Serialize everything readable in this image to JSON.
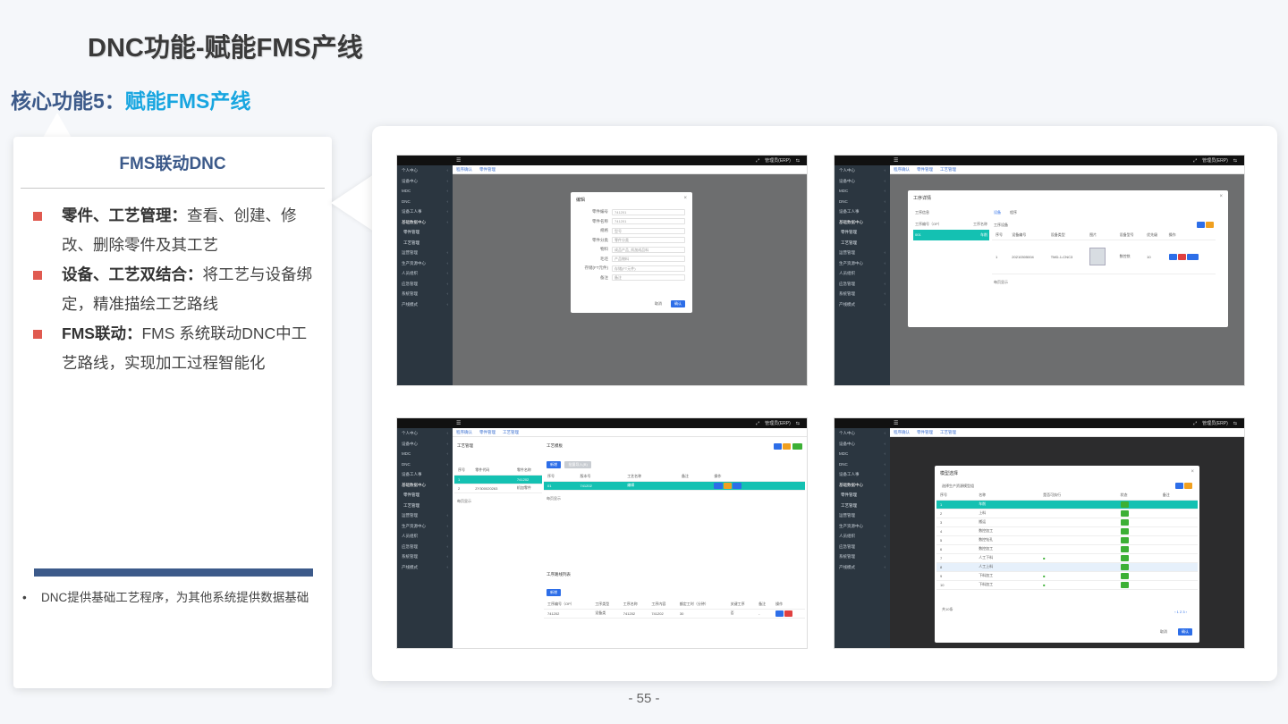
{
  "slide": {
    "title": "DNC功能-赋能FMS产线",
    "subtitle_prefix": "核心功能5：",
    "subtitle_highlight": "赋能FMS产线",
    "page_number": "- 55 -"
  },
  "card": {
    "heading": "FMS联动DNC",
    "bullets": [
      {
        "bold": "零件、工艺管理：",
        "text": "查看、创建、修改、删除零件及其工艺"
      },
      {
        "bold": "设备、工艺双结合：",
        "text": "将工艺与设备绑定，精准描绘工艺路线"
      },
      {
        "bold": "FMS联动：",
        "text": "FMS 系统联动DNC中工艺路线，实现加工过程智能化"
      }
    ],
    "note": "DNC提供基础工艺程序，为其他系统提供数据基础"
  },
  "colors": {
    "accent_blue": "#3c5a8a",
    "highlight": "#18a6e0",
    "bullet_red": "#e05a50",
    "teal_select": "#14c1b2"
  },
  "screenshots": {
    "sidebar_items": [
      "个人中心",
      "设备中心",
      "MDC",
      "DNC",
      "设备工人事",
      "基础数据中心",
      "零件管理",
      "工艺管理",
      "运营管理",
      "生产资源中心",
      "人员组织",
      "应急管理",
      "系统管理",
      "产线模式"
    ],
    "user_label": "管理员(ERP)",
    "shot1": {
      "tabs": [
        "程序确认",
        "零件管理"
      ],
      "dialog_title": "编辑",
      "fields": [
        {
          "label": "零件编号",
          "value": "741201"
        },
        {
          "label": "零件名称",
          "value": "741201"
        },
        {
          "label": "规格",
          "value": "型号"
        },
        {
          "label": "零件分类",
          "value": "零件分类"
        },
        {
          "label": "物料",
          "value": "成品产品_机加成品料"
        },
        {
          "label": "毛坯",
          "value": "产品物料"
        },
        {
          "label": "存储(FT元件)",
          "value": "存储(FT元件)"
        },
        {
          "label": "备注",
          "value": "备注"
        }
      ],
      "cancel": "取消",
      "confirm": "确认"
    },
    "shot2": {
      "tabs": [
        "程序确认",
        "零件管理",
        "工艺管理"
      ],
      "dialog_title": "工序详情",
      "left_tabs": [
        "工序信息"
      ],
      "left_cols": [
        "工序编号（OP）",
        "工序名称"
      ],
      "left_row": [
        "001",
        "车削"
      ],
      "right_tabs": [
        "设备",
        "程序"
      ],
      "right_label": "工序设备",
      "table_cols": [
        "序号",
        "设备编号",
        "设备类型",
        "图片",
        "设备型号",
        "优先级",
        "操作"
      ],
      "row": [
        "1",
        "20210305004",
        "TMD-1-CNC3",
        "",
        "数控铣",
        "10",
        ""
      ],
      "pager": "每页显示"
    },
    "shot3": {
      "tabs": [
        "程序确认",
        "零件管理",
        "工艺管理"
      ],
      "left_title": "工艺管理",
      "left_cols": [
        "序号",
        "零件代码",
        "零件名称"
      ],
      "left_rows": [
        [
          "1",
          "",
          "741202"
        ],
        [
          "2",
          "ZY300020263",
          "机加零件"
        ]
      ],
      "right_title": "工艺模板",
      "btn_add": "新增",
      "btn_import": "批量导入(B)",
      "right_cols": [
        "序号",
        "版本号",
        "工艺名称",
        "备注",
        "操作"
      ],
      "right_row": [
        "01",
        "741202",
        "编辑",
        "",
        ""
      ],
      "bottom_title": "工序路线列表",
      "bottom_cols": [
        "工序编号（OP）",
        "工序类型",
        "工序名称",
        "工序内容",
        "额定工时（分钟）",
        "关键工序",
        "备注",
        "操作"
      ],
      "bottom_row": [
        "741202",
        "设备类",
        "741202",
        "741202",
        "30",
        "否",
        "-",
        ""
      ],
      "pager": "每页显示"
    },
    "shot4": {
      "tabs": [
        "程序确认",
        "零件管理",
        "工艺管理"
      ],
      "dialog_title": "模型选择",
      "subtitle": "选择生产资源模型组",
      "cols": [
        "序号",
        "名称",
        "是否可执行",
        "状态",
        "备注"
      ],
      "rows": [
        [
          "1",
          "车削"
        ],
        [
          "2",
          "上料"
        ],
        [
          "3",
          "搬运"
        ],
        [
          "4",
          "数控加工"
        ],
        [
          "5",
          "数控钻孔"
        ],
        [
          "6",
          "数控加工"
        ],
        [
          "7",
          "人工下料"
        ],
        [
          "8",
          "人工上料"
        ],
        [
          "9",
          "下料加工"
        ],
        [
          "10",
          "下料加工"
        ]
      ],
      "footer_count": "共10条",
      "cancel": "取消",
      "confirm": "确认"
    }
  }
}
